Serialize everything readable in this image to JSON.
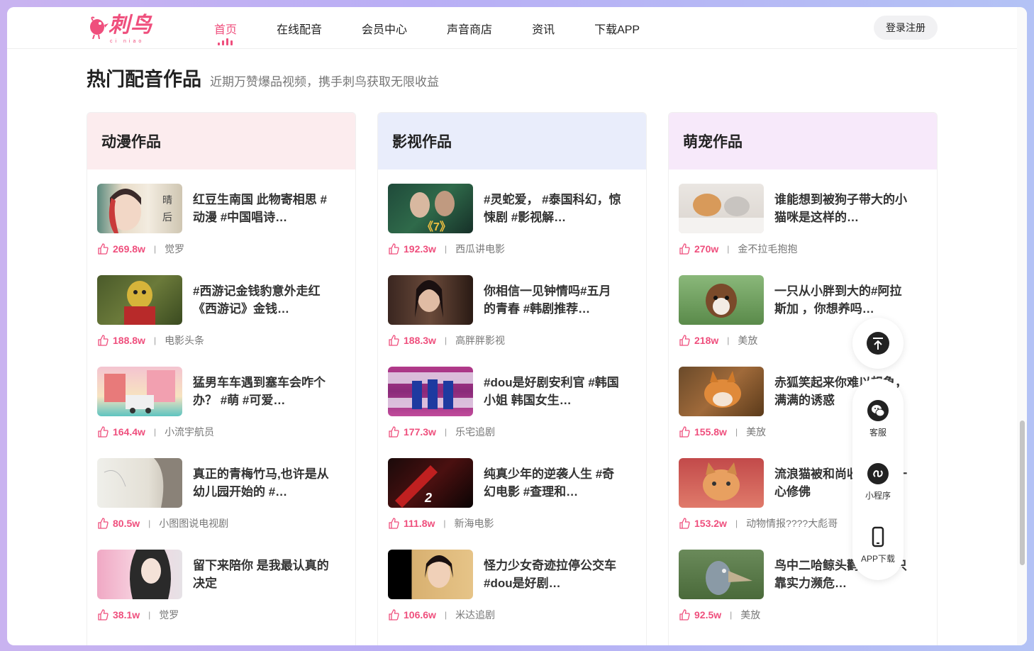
{
  "logo": {
    "text": "刺鸟",
    "sub": "ci niao"
  },
  "nav": [
    {
      "label": "首页",
      "active": true
    },
    {
      "label": "在线配音"
    },
    {
      "label": "会员中心"
    },
    {
      "label": "声音商店"
    },
    {
      "label": "资讯"
    },
    {
      "label": "下载APP"
    }
  ],
  "login_label": "登录注册",
  "section": {
    "title": "热门配音作品",
    "subtitle": "近期万赞爆品视频，携手刺鸟获取无限收益"
  },
  "colors": {
    "accent": "#ef4f7d",
    "anime_head": "#fcecee",
    "film_head": "#e9edfb",
    "pet_head": "#f7e9fa"
  },
  "columns": [
    {
      "title": "动漫作品",
      "items": [
        {
          "title": "红豆生南国  此物寄相思 #动漫 #中国唱诗…",
          "likes": "269.8w",
          "author": "觉罗"
        },
        {
          "title": "#西游记金钱豹意外走红《西游记》金钱…",
          "likes": "188.8w",
          "author": "电影头条"
        },
        {
          "title": "猛男车车遇到塞车会咋个办？ #萌 #可爱…",
          "likes": "164.4w",
          "author": "小流宇航员"
        },
        {
          "title": "真正的青梅竹马,也许是从幼儿园开始的 #…",
          "likes": "80.5w",
          "author": "小图图说电视剧"
        },
        {
          "title": "留下来陪你  是我最认真的决定",
          "likes": "38.1w",
          "author": "觉罗"
        }
      ]
    },
    {
      "title": "影视作品",
      "items": [
        {
          "title": " #灵蛇爱， #泰国科幻，惊悚剧 #影视解…",
          "likes": "192.3w",
          "author": "西瓜讲电影"
        },
        {
          "title": "你相信一见钟情吗#五月的青春 #韩剧推荐…",
          "likes": "188.3w",
          "author": "高胖胖影视"
        },
        {
          "title": "#dou是好剧安利官  #韩国小姐 韩国女生…",
          "likes": "177.3w",
          "author": "乐宅追剧"
        },
        {
          "title": "纯真少年的逆袭人生 #奇幻电影  #查理和…",
          "likes": "111.8w",
          "author": "新海电影"
        },
        {
          "title": "怪力少女奇迹拉停公交车  #dou是好剧…",
          "likes": "106.6w",
          "author": "米达追剧"
        }
      ]
    },
    {
      "title": "萌宠作品",
      "items": [
        {
          "title": "谁能想到被狗子带大的小猫咪是这样的…",
          "likes": "270w",
          "author": "金不拉毛抱抱"
        },
        {
          "title": "一只从小胖到大的#阿拉斯加 ，你想养吗…",
          "likes": "218w",
          "author": "美放"
        },
        {
          "title": "赤狐笑起来你难以想象，满满的诱惑",
          "likes": "155.8w",
          "author": "美放"
        },
        {
          "title": "流浪猫被和尚收养后，一心修佛",
          "likes": "153.2w",
          "author": "动物情报????大彪哥"
        },
        {
          "title": "鸟中二哈鲸头鹳，是一只靠实力濒危…",
          "likes": "92.5w",
          "author": "美放"
        }
      ]
    }
  ],
  "float": [
    {
      "label": "客服",
      "icon": "wechat-icon"
    },
    {
      "label": "小程序",
      "icon": "miniprogram-icon"
    },
    {
      "label": "APP下载",
      "icon": "phone-icon"
    }
  ]
}
